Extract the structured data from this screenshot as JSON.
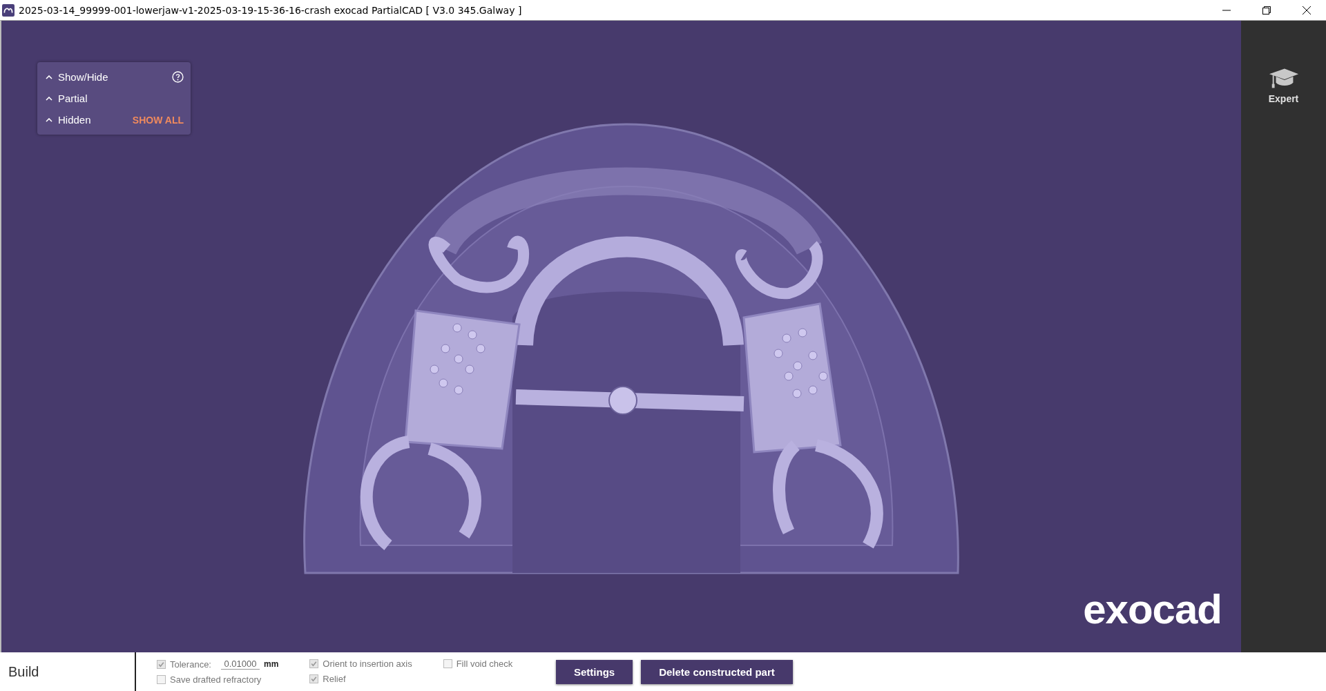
{
  "window": {
    "title": "2025-03-14_99999-001-lowerjaw-v1-2025-03-19-15-36-16-crash exocad PartialCAD [ V3.0 345.Galway ]"
  },
  "panel": {
    "rows": [
      {
        "label": "Show/Hide",
        "kind": "help"
      },
      {
        "label": "Partial",
        "kind": "plain"
      },
      {
        "label": "Hidden",
        "kind": "action",
        "action": "SHOW ALL"
      }
    ]
  },
  "logo": "exocad",
  "sidebar": {
    "items": [
      {
        "label": "Expert"
      }
    ]
  },
  "bottom_bar": {
    "section": "Build",
    "options": [
      {
        "kind": "tolerance",
        "label": "Tolerance:",
        "value": "0.01000",
        "unit": "mm",
        "checked": true
      },
      {
        "kind": "check",
        "label": "Save drafted refractory",
        "checked": false
      },
      {
        "kind": "check",
        "label": "Orient to insertion axis",
        "checked": true
      },
      {
        "kind": "check",
        "label": "Relief",
        "checked": true
      },
      {
        "kind": "check",
        "label": "Fill void check",
        "checked": false
      }
    ],
    "buttons": [
      "Settings",
      "Delete constructed part"
    ]
  }
}
